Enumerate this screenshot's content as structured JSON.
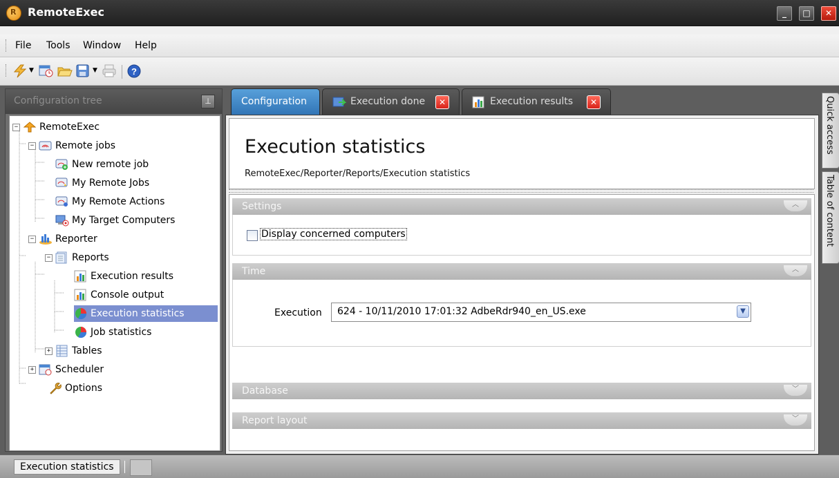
{
  "app": {
    "title": "RemoteExec"
  },
  "window": {
    "minimize": "_",
    "maximize": "□",
    "close": "✕"
  },
  "menu": {
    "file": "File",
    "tools": "Tools",
    "window": "Window",
    "help": "Help"
  },
  "toolbar": {
    "icons": [
      "lightning-icon",
      "schedule-icon",
      "open-folder-icon",
      "save-icon",
      "print-icon",
      "help-icon"
    ]
  },
  "left_panel": {
    "title": "Configuration tree",
    "pin": "⊥",
    "tree": [
      {
        "label": "RemoteExec",
        "expander": "−",
        "icon": "remoteexec-icon"
      },
      {
        "label": "Remote jobs",
        "expander": "−",
        "icon": "remote-jobs-icon"
      },
      {
        "label": "New remote job",
        "expander": "+",
        "icon": "new-job-icon"
      },
      {
        "label": "My Remote Jobs",
        "expander": "+",
        "icon": "my-jobs-icon"
      },
      {
        "label": "My Remote Actions",
        "expander": "+",
        "icon": "my-actions-icon"
      },
      {
        "label": "My Target Computers",
        "expander": "+",
        "icon": "target-computers-icon"
      },
      {
        "label": "Reporter",
        "expander": "−",
        "icon": "reporter-icon"
      },
      {
        "label": "Reports",
        "expander": "−",
        "icon": "reports-icon"
      },
      {
        "label": "Execution results",
        "icon": "bar-chart-icon"
      },
      {
        "label": "Console output",
        "icon": "bar-chart-icon"
      },
      {
        "label": "Execution statistics",
        "icon": "pie-chart-icon",
        "selected": true
      },
      {
        "label": "Job statistics",
        "icon": "pie-chart-icon"
      },
      {
        "label": "Tables",
        "expander": "+",
        "icon": "table-icon"
      },
      {
        "label": "Scheduler",
        "expander": "+",
        "icon": "scheduler-icon"
      },
      {
        "label": "Options",
        "icon": "wrench-icon"
      }
    ]
  },
  "tabs": [
    {
      "label": "Configuration",
      "active": true
    },
    {
      "label": "Execution done",
      "closable": true
    },
    {
      "label": "Execution results",
      "closable": true
    }
  ],
  "page": {
    "title": "Execution statistics",
    "breadcrumb": "RemoteExec/Reporter/Reports/Execution statistics"
  },
  "sections": {
    "settings": {
      "title": "Settings",
      "checkbox_label": "Display concerned computers",
      "checked": false
    },
    "time": {
      "title": "Time",
      "execution_label": "Execution",
      "execution_value": "624 - 10/11/2010 17:01:32 AdbeRdr940_en_US.exe"
    },
    "database": {
      "title": "Database"
    },
    "report_layout": {
      "title": "Report layout"
    }
  },
  "side_tabs": {
    "quick_access": "Quick access",
    "table_of_content": "Table of content"
  },
  "status": {
    "text": "Execution statistics"
  }
}
